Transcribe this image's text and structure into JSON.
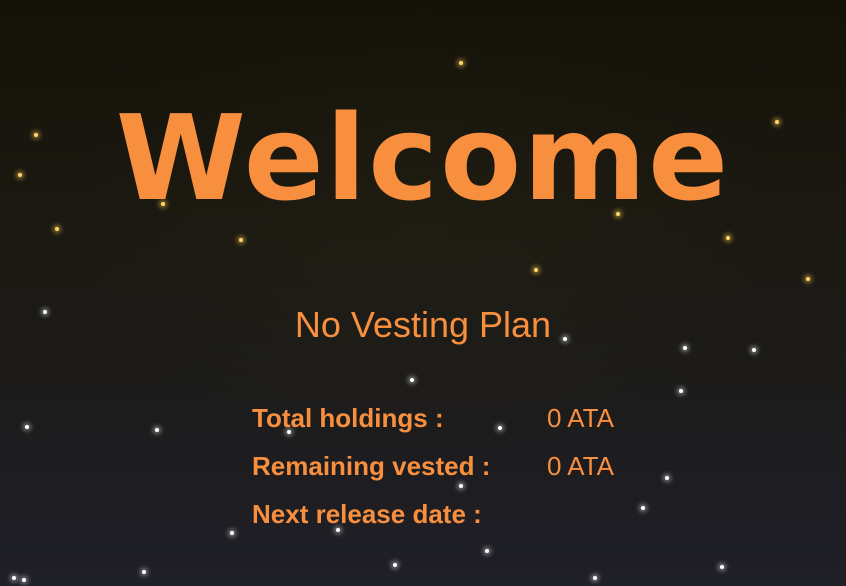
{
  "header": {
    "title": "Welcome"
  },
  "vesting": {
    "status": "No Vesting Plan",
    "rows": [
      {
        "label": "Total holdings :",
        "value": "0 ATA"
      },
      {
        "label": "Remaining vested :",
        "value": "0 ATA"
      },
      {
        "label": "Next release date :",
        "value": ""
      }
    ]
  },
  "theme": {
    "accent": "#f78f3e",
    "background": "#1a1810"
  }
}
